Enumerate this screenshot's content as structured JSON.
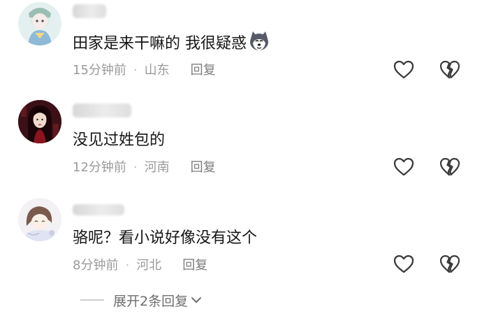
{
  "comments": [
    {
      "text": "田家是来干嘛的 我很疑惑",
      "emoji": "husky-dog-emoji",
      "time": "15分钟前",
      "location": "山东",
      "reply_label": "回复"
    },
    {
      "text": "没见过姓包的",
      "time": "12分钟前",
      "location": "河南",
      "reply_label": "回复"
    },
    {
      "text": "骆呢？看小说好像没有这个",
      "time": "8分钟前",
      "location": "河北",
      "reply_label": "回复"
    }
  ],
  "separator": "·",
  "expand_replies": "展开2条回复",
  "icons": {
    "like": "heart-outline-icon",
    "dislike": "broken-heart-outline-icon",
    "expand": "chevron-down-icon"
  },
  "colors": {
    "text": "#161616",
    "meta": "#9a9a9a",
    "icon": "#3a3a3a"
  }
}
